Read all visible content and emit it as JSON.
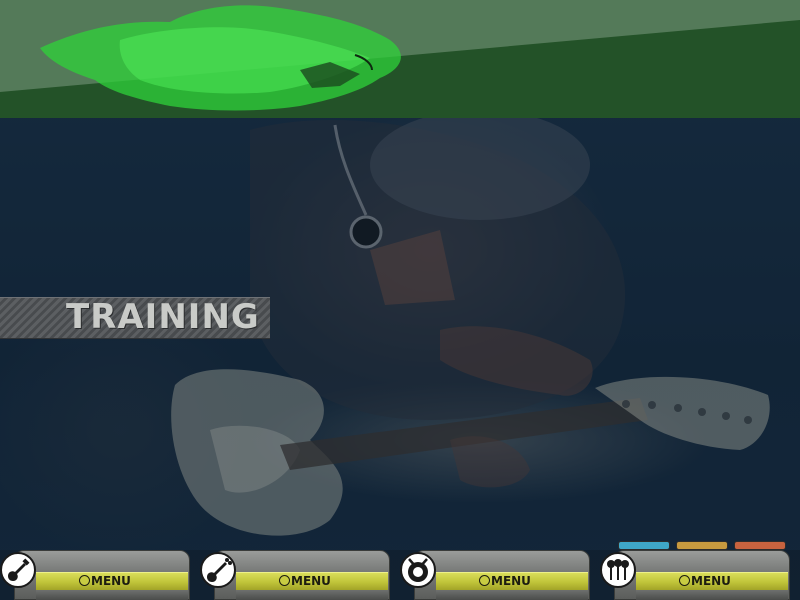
{
  "screen": {
    "title": "TRAINING"
  },
  "panels": [
    {
      "id": "guitar",
      "icon": "guitar-icon",
      "menu_label": "MENU"
    },
    {
      "id": "bass",
      "icon": "bass-guitar-icon",
      "menu_label": "MENU"
    },
    {
      "id": "drums",
      "icon": "drum-icon",
      "menu_label": "MENU"
    },
    {
      "id": "vocals",
      "icon": "microphone-icon",
      "menu_label": "MENU"
    }
  ],
  "meters": [
    {
      "name": "meter-1",
      "color": "#3fa7c7"
    },
    {
      "name": "meter-2",
      "color": "#c79a3f"
    },
    {
      "name": "meter-3",
      "color": "#c7633f"
    }
  ],
  "colors": {
    "banner_green": "#235228",
    "accent_green": "#2fd33a",
    "menu_bar_yellow": "#c1c53a"
  }
}
